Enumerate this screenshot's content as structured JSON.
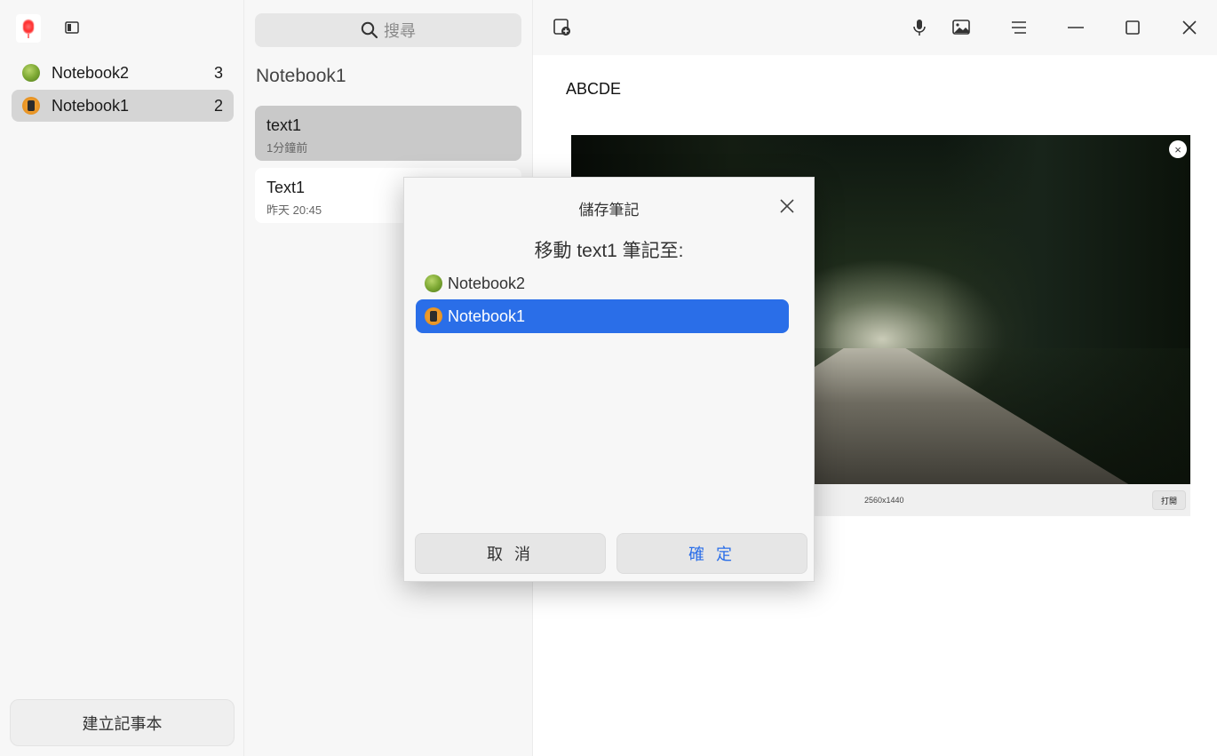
{
  "sidebar": {
    "notebooks": [
      {
        "name": "Notebook2",
        "count": "3",
        "icon": "green-globe-icon"
      },
      {
        "name": "Notebook1",
        "count": "2",
        "icon": "orange-bookmark-icon",
        "selected": true
      }
    ],
    "create_button": "建立記事本"
  },
  "list": {
    "search_placeholder": "搜尋",
    "title": "Notebook1",
    "notes": [
      {
        "title": "text1",
        "time": "1分鐘前",
        "selected": true
      },
      {
        "title": "Text1",
        "time": "昨天 20:45"
      }
    ]
  },
  "editor": {
    "text": "ABCDE",
    "image": {
      "resolution": "2560x1440",
      "open_label": "打開",
      "close_label": "×"
    }
  },
  "dialog": {
    "title": "儲存筆記",
    "subtitle": "移動 text1 筆記至:",
    "items": [
      {
        "name": "Notebook2"
      },
      {
        "name": "Notebook1",
        "selected": true
      }
    ],
    "cancel": "取 消",
    "ok": "確 定"
  },
  "colors": {
    "accent": "#2a6ee8",
    "selection_gray": "#d5d5d5"
  }
}
